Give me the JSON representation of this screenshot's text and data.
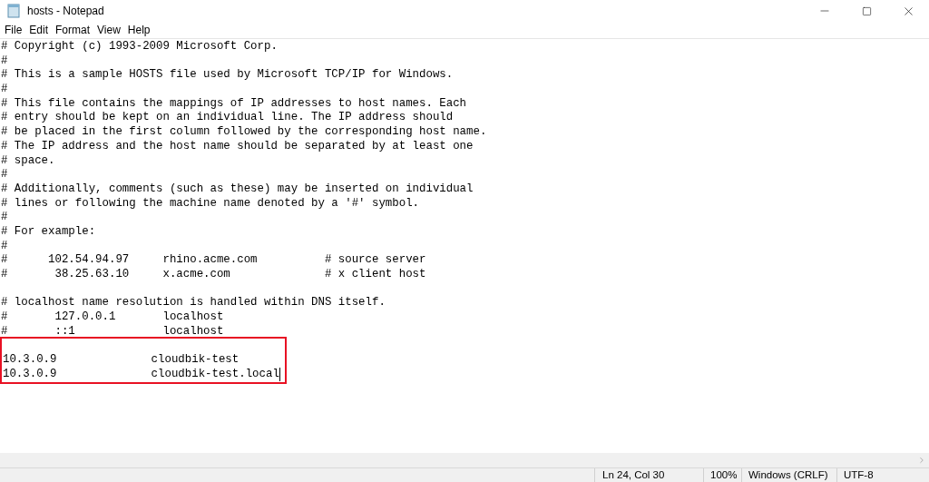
{
  "window": {
    "title": "hosts - Notepad"
  },
  "menu": [
    {
      "label": "File"
    },
    {
      "label": "Edit"
    },
    {
      "label": "Format"
    },
    {
      "label": "View"
    },
    {
      "label": "Help"
    }
  ],
  "lines": [
    {
      "kind": "text",
      "text": "# Copyright (c) 1993-2009 Microsoft Corp.",
      "highlighted": false,
      "cursor": false
    },
    {
      "kind": "text",
      "text": "#",
      "highlighted": false,
      "cursor": false
    },
    {
      "kind": "text",
      "text": "# This is a sample HOSTS file used by Microsoft TCP/IP for Windows.",
      "highlighted": false,
      "cursor": false
    },
    {
      "kind": "text",
      "text": "#",
      "highlighted": false,
      "cursor": false
    },
    {
      "kind": "text",
      "text": "# This file contains the mappings of IP addresses to host names. Each",
      "highlighted": false,
      "cursor": false
    },
    {
      "kind": "text",
      "text": "# entry should be kept on an individual line. The IP address should",
      "highlighted": false,
      "cursor": false
    },
    {
      "kind": "text",
      "text": "# be placed in the first column followed by the corresponding host name.",
      "highlighted": false,
      "cursor": false
    },
    {
      "kind": "text",
      "text": "# The IP address and the host name should be separated by at least one",
      "highlighted": false,
      "cursor": false
    },
    {
      "kind": "text",
      "text": "# space.",
      "highlighted": false,
      "cursor": false
    },
    {
      "kind": "text",
      "text": "#",
      "highlighted": false,
      "cursor": false
    },
    {
      "kind": "text",
      "text": "# Additionally, comments (such as these) may be inserted on individual",
      "highlighted": false,
      "cursor": false
    },
    {
      "kind": "text",
      "text": "# lines or following the machine name denoted by a '#' symbol.",
      "highlighted": false,
      "cursor": false
    },
    {
      "kind": "text",
      "text": "#",
      "highlighted": false,
      "cursor": false
    },
    {
      "kind": "text",
      "text": "# For example:",
      "highlighted": false,
      "cursor": false
    },
    {
      "kind": "text",
      "text": "#",
      "highlighted": false,
      "cursor": false
    },
    {
      "kind": "text",
      "text": "#      102.54.94.97     rhino.acme.com          # source server",
      "highlighted": false,
      "cursor": false
    },
    {
      "kind": "text",
      "text": "#       38.25.63.10     x.acme.com              # x client host",
      "highlighted": false,
      "cursor": false
    },
    {
      "kind": "blank",
      "highlighted": false,
      "cursor": false
    },
    {
      "kind": "text",
      "text": "# localhost name resolution is handled within DNS itself.",
      "highlighted": false,
      "cursor": false
    },
    {
      "kind": "text",
      "text": "#       127.0.0.1       localhost",
      "highlighted": false,
      "cursor": false
    },
    {
      "kind": "text",
      "text": "#       ::1             localhost",
      "highlighted": false,
      "cursor": false
    },
    {
      "kind": "blank",
      "highlighted": true,
      "cursor": false
    },
    {
      "kind": "text",
      "text": "10.3.0.9              cloudbik-test",
      "highlighted": true,
      "cursor": false
    },
    {
      "kind": "text",
      "text": "10.3.0.9              cloudbik-test.local",
      "highlighted": true,
      "cursor": true
    }
  ],
  "status_bar": {
    "position": "Ln 24, Col 30",
    "zoom": "100%",
    "line_endings": "Windows (CRLF)",
    "encoding": "UTF-8"
  }
}
